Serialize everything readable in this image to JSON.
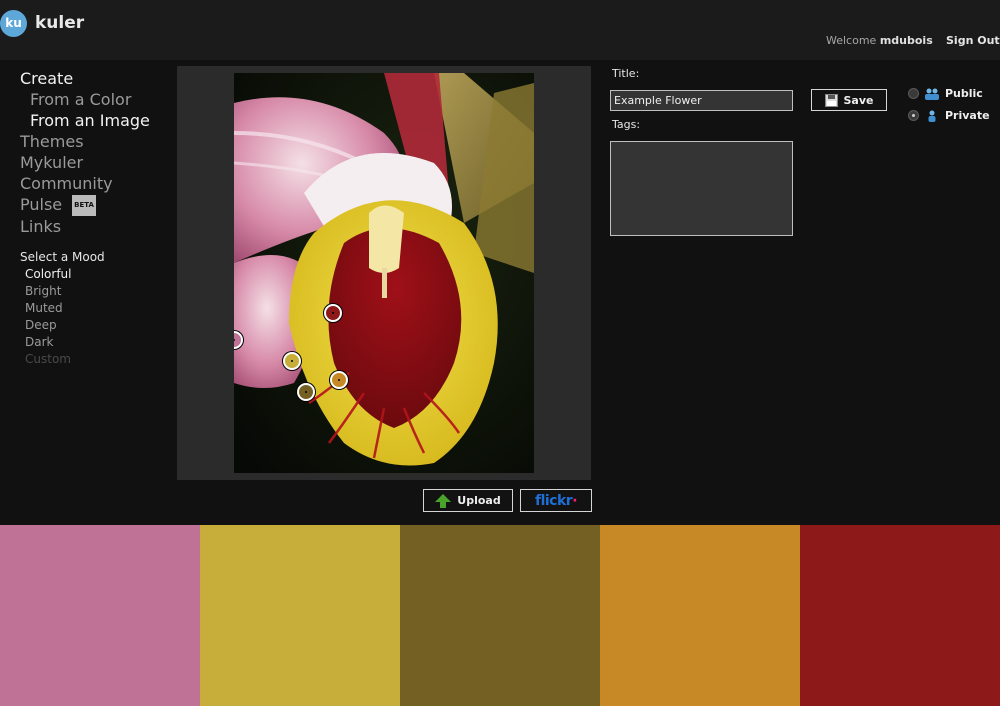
{
  "header": {
    "logo_text": "ku",
    "app_name": "kuler",
    "welcome_prefix": "Welcome",
    "username": "mdubois",
    "sign_out": "Sign Out"
  },
  "nav": {
    "create": "Create",
    "from_color": "From a Color",
    "from_image": "From an Image",
    "themes": "Themes",
    "mykuler": "Mykuler",
    "community": "Community",
    "pulse": "Pulse",
    "beta_badge": "BETA",
    "links": "Links"
  },
  "mood": {
    "title": "Select a Mood",
    "options": [
      "Colorful",
      "Bright",
      "Muted",
      "Deep",
      "Dark",
      "Custom"
    ],
    "selected": "Colorful"
  },
  "buttons": {
    "upload": "Upload",
    "flickr_main": "flickr",
    "flickr_dot": "·",
    "save": "Save"
  },
  "form": {
    "title_label": "Title:",
    "title_value": "Example Flower",
    "tags_label": "Tags:",
    "tags_value": "",
    "public_label": "Public",
    "private_label": "Private",
    "visibility": "Private"
  },
  "palette": {
    "swatches": [
      "#c07196",
      "#c7ad3a",
      "#756024",
      "#c68925",
      "#8d1a19"
    ]
  },
  "icons": {
    "upload": "upload-arrow-icon",
    "save": "floppy-disk-icon",
    "public": "group-users-icon",
    "private": "single-user-icon"
  }
}
